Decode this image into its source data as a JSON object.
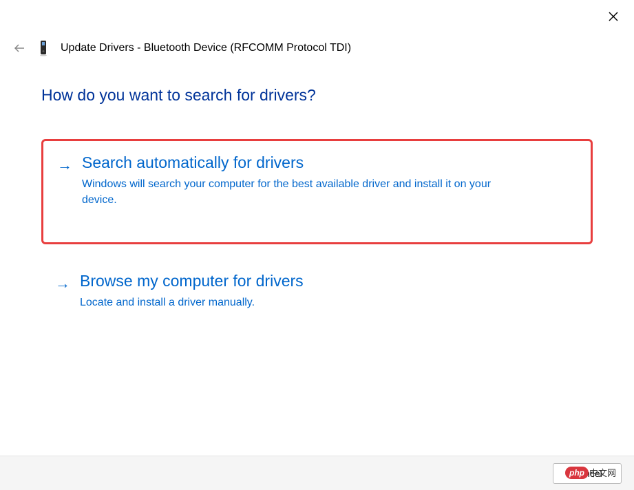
{
  "header": {
    "title": "Update Drivers - Bluetooth Device (RFCOMM Protocol TDI)"
  },
  "heading": "How do you want to search for drivers?",
  "options": [
    {
      "title": "Search automatically for drivers",
      "desc": "Windows will search your computer for the best available driver and install it on your device."
    },
    {
      "title": "Browse my computer for drivers",
      "desc": "Locate and install a driver manually."
    }
  ],
  "footer": {
    "cancel_label": "Cancel"
  },
  "watermark": {
    "logo": "php",
    "text": "中文网"
  }
}
